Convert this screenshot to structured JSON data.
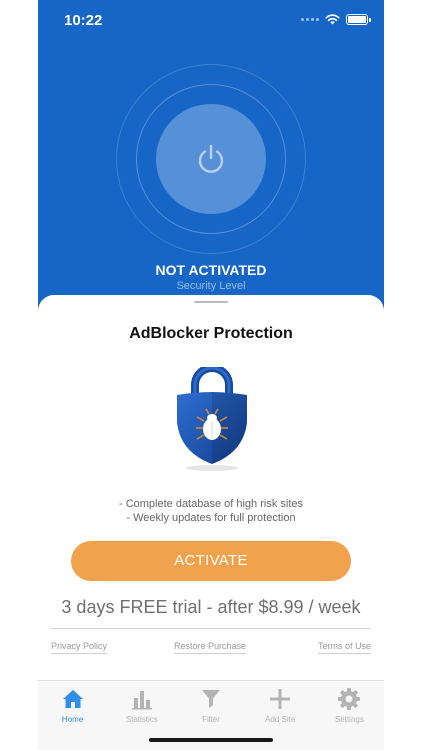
{
  "status_bar": {
    "time": "10:22"
  },
  "hero": {
    "status": "NOT ACTIVATED",
    "caption": "Security Level",
    "power_icon": "power-icon"
  },
  "sheet": {
    "title": "AdBlocker Protection",
    "features": [
      "- Complete database of high risk sites",
      "- Weekly updates for full protection"
    ],
    "activate_label": "ACTIVATE",
    "trial": "3 days FREE trial - after $8.99 / week",
    "links": {
      "privacy": "Privacy Policy",
      "restore": "Restore Purchase",
      "terms": "Terms of Use"
    }
  },
  "tabs": [
    {
      "label": "Home",
      "icon": "home-icon",
      "active": true
    },
    {
      "label": "Statistics",
      "icon": "bar-chart-icon",
      "active": false
    },
    {
      "label": "Filter",
      "icon": "funnel-icon",
      "active": false
    },
    {
      "label": "Add Site",
      "icon": "plus-icon",
      "active": false
    },
    {
      "label": "Settings",
      "icon": "gear-icon",
      "active": false
    }
  ],
  "colors": {
    "background": "#1566c6",
    "accent_button": "#f0a24d",
    "active_tab": "#2f8fe6",
    "inactive_tab": "#b3b3b3"
  }
}
